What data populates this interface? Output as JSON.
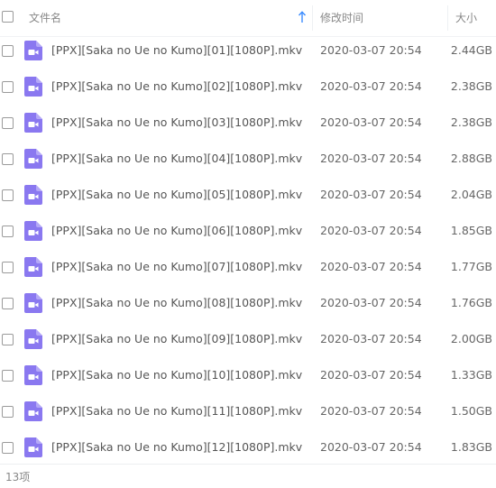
{
  "header": {
    "name_label": "文件名",
    "date_label": "修改时间",
    "size_label": "大小",
    "sort_icon": "arrow-up-icon"
  },
  "colors": {
    "icon_purple": "#8a78f0",
    "sort_blue": "#3b8cff"
  },
  "files": [
    {
      "name": "[PPX][Saka no Ue no Kumo][01][1080P].mkv",
      "date": "2020-03-07 20:54",
      "size": "2.44GB"
    },
    {
      "name": "[PPX][Saka no Ue no Kumo][02][1080P].mkv",
      "date": "2020-03-07 20:54",
      "size": "2.38GB"
    },
    {
      "name": "[PPX][Saka no Ue no Kumo][03][1080P].mkv",
      "date": "2020-03-07 20:54",
      "size": "2.38GB"
    },
    {
      "name": "[PPX][Saka no Ue no Kumo][04][1080P].mkv",
      "date": "2020-03-07 20:54",
      "size": "2.88GB"
    },
    {
      "name": "[PPX][Saka no Ue no Kumo][05][1080P].mkv",
      "date": "2020-03-07 20:54",
      "size": "2.04GB"
    },
    {
      "name": "[PPX][Saka no Ue no Kumo][06][1080P].mkv",
      "date": "2020-03-07 20:54",
      "size": "1.85GB"
    },
    {
      "name": "[PPX][Saka no Ue no Kumo][07][1080P].mkv",
      "date": "2020-03-07 20:54",
      "size": "1.77GB"
    },
    {
      "name": "[PPX][Saka no Ue no Kumo][08][1080P].mkv",
      "date": "2020-03-07 20:54",
      "size": "1.76GB"
    },
    {
      "name": "[PPX][Saka no Ue no Kumo][09][1080P].mkv",
      "date": "2020-03-07 20:54",
      "size": "2.00GB"
    },
    {
      "name": "[PPX][Saka no Ue no Kumo][10][1080P].mkv",
      "date": "2020-03-07 20:54",
      "size": "1.33GB"
    },
    {
      "name": "[PPX][Saka no Ue no Kumo][11][1080P].mkv",
      "date": "2020-03-07 20:54",
      "size": "1.50GB"
    },
    {
      "name": "[PPX][Saka no Ue no Kumo][12][1080P].mkv",
      "date": "2020-03-07 20:54",
      "size": "1.83GB"
    }
  ],
  "footer": {
    "count_label": "13项"
  }
}
